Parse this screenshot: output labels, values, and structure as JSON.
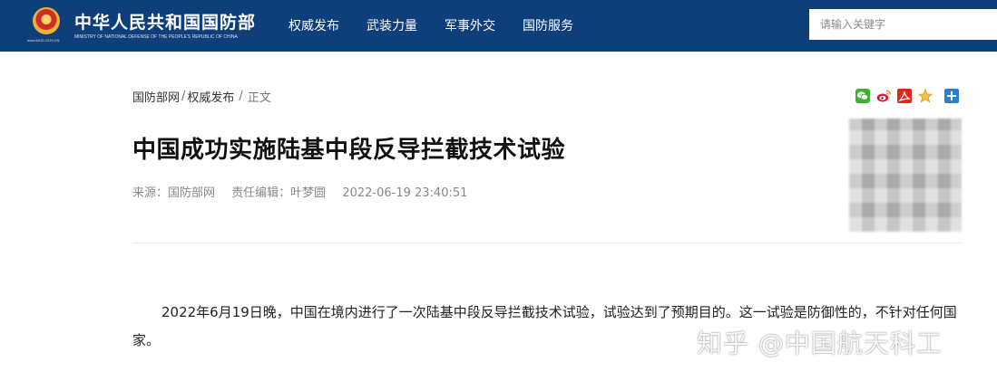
{
  "header": {
    "site_name": "中华人民共和国国防部",
    "site_subtitle": "MINISTRY OF NATIONAL DEFENSE OF THE PEOPLE'S REPUBLIC OF CHINA",
    "site_url": "www.MOD.GOV.CN",
    "nav": [
      "权威发布",
      "武装力量",
      "军事外交",
      "国防服务"
    ],
    "search_placeholder": "请输入关键字",
    "colors": {
      "bar": "#0f3f7b",
      "text": "#ffffff"
    }
  },
  "breadcrumb": {
    "items": [
      "国防部网",
      "权威发布"
    ],
    "separator": "/",
    "current": "正文"
  },
  "share_icons": [
    "wechat-icon",
    "weibo-icon",
    "pdf-icon",
    "favorite-star-icon",
    "add-icon"
  ],
  "article": {
    "title": "中国成功实施陆基中段反导拦截技术试验",
    "source": "来源：国防部网",
    "editor": "责任编辑：叶梦圆",
    "datetime": "2022-06-19 23:40:51",
    "body": "2022年6月19日晚，中国在境内进行了一次陆基中段反导拦截技术试验，试验达到了预期目的。这一试验是防御性的，不针对任何国家。"
  },
  "watermark": "知乎 @中国航天科工"
}
